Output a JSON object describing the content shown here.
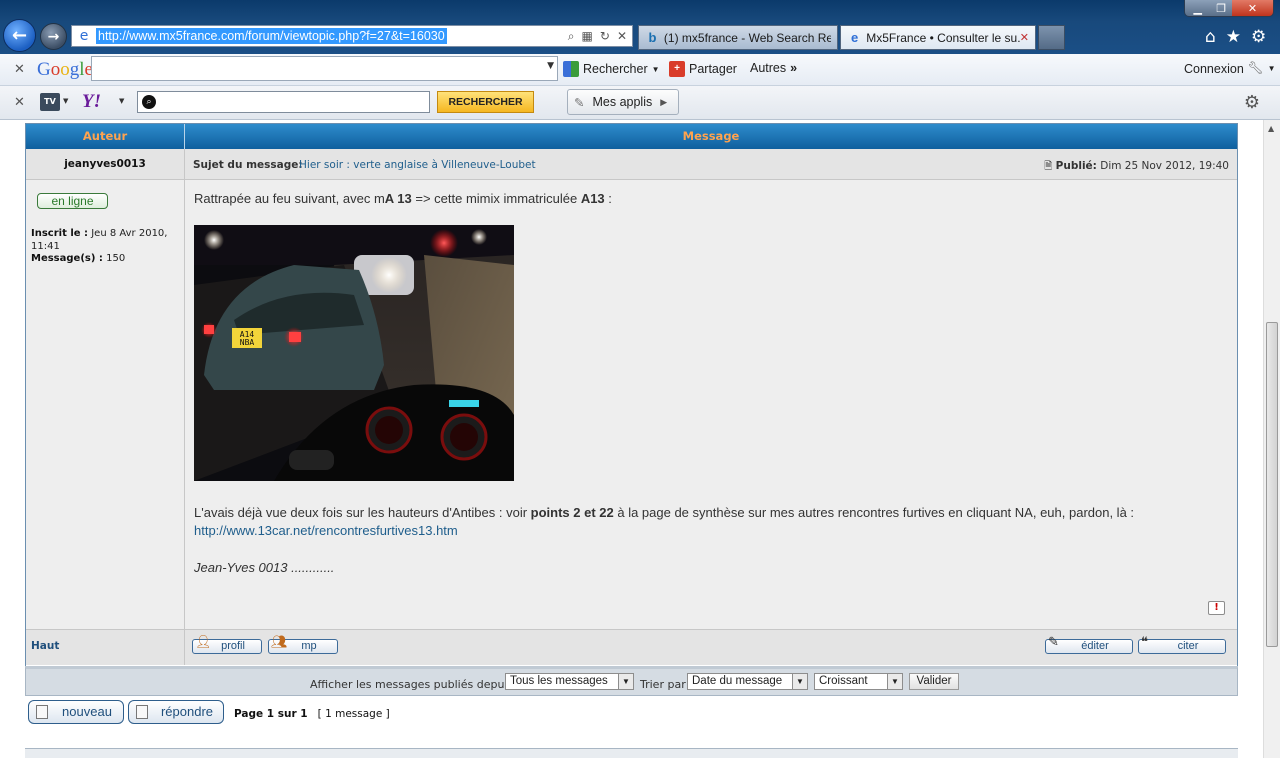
{
  "browser": {
    "url": "http://www.mx5france.com/forum/viewtopic.php?f=27&t=16030",
    "tabs": [
      {
        "label": "(1) mx5france - Web Search Re...",
        "icon": "bing-icon"
      },
      {
        "label": "Mx5France • Consulter le su...",
        "icon": "ie-icon"
      }
    ]
  },
  "google_toolbar": {
    "rechercher": "Rechercher",
    "partager": "Partager",
    "autres": "Autres",
    "connexion": "Connexion"
  },
  "yahoo_toolbar": {
    "search_button": "RECHERCHER",
    "apps": "Mes applis"
  },
  "forum": {
    "header_author": "Auteur",
    "header_message": "Message",
    "author": {
      "name": "jeanyves0013",
      "status": "en ligne",
      "registered_label": "Inscrit le :",
      "registered_value": "Jeu 8 Avr 2010, 11:41",
      "posts_label": "Message(s) :",
      "posts_value": "150"
    },
    "subject_label": "Sujet du message:",
    "subject_value": "Hier soir : verte anglaise à Villeneuve-Loubet",
    "published_label": "Publié:",
    "published_value": "Dim 25 Nov 2012, 19:40",
    "post": {
      "line1_a": "Rattrapée au feu suivant, avec m",
      "line1_b": "A 13",
      "line1_c": " => cette mimix immatriculée ",
      "line1_d": "A13",
      "line1_e": " :",
      "line2_a": "L'avais déjà vue deux fois sur les hauteurs d'Antibes : voir ",
      "line2_b": "points 2 et 22",
      "line2_c": " à la page de synthèse sur mes autres rencontres furtives en cliquant NA, euh, pardon, là :",
      "link": "http://www.13car.net/rencontresfurtives13.htm",
      "signature": "Jean-Yves 0013 ............"
    },
    "plate_text": "A14 NBA",
    "haut": "Haut",
    "buttons": {
      "profil": "profil",
      "mp": "mp",
      "editer": "éditer",
      "citer": "citer"
    },
    "filter": {
      "label": "Afficher les messages publiés depuis :",
      "since_value": "Tous les messages",
      "sort_label": "Trier par",
      "sort_value": "Date du message",
      "order_value": "Croissant",
      "submit": "Valider"
    },
    "new_topic": "nouveau",
    "reply": "répondre",
    "page_info_bold": "Page 1 sur 1",
    "page_info_rest": "[ 1 message ]"
  }
}
